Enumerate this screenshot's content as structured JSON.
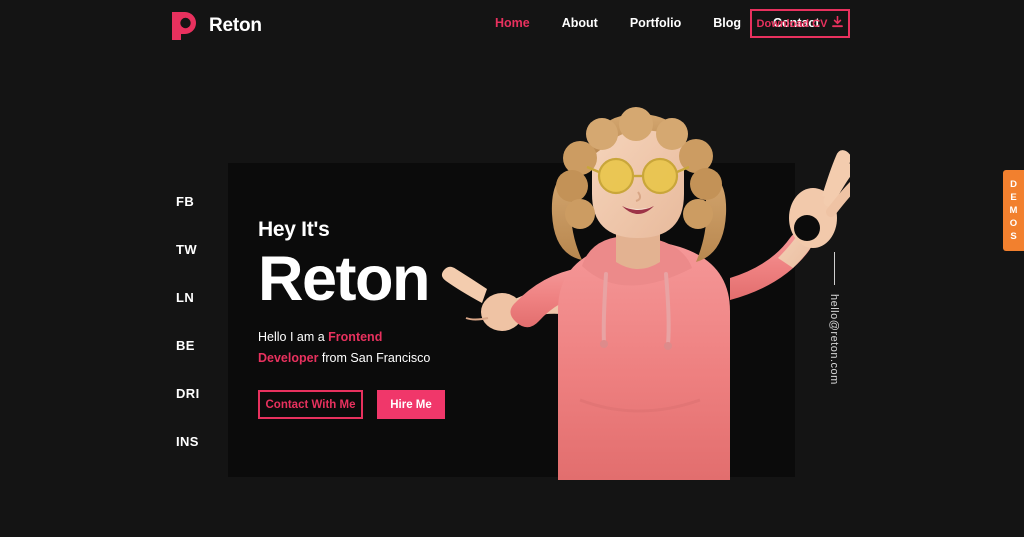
{
  "colors": {
    "background": "#141414",
    "panel": "#0B0B0B",
    "accent_pink": "#E8315E",
    "accent_pink_solid": "#F0376A",
    "demos_orange": "#F2802E",
    "text_white": "#FFFFFF",
    "hoodie_pink": "#F08080",
    "sunglasses_yellow": "#E8C547",
    "hair_blonde": "#C89A67"
  },
  "header": {
    "brand": {
      "name": "Reton",
      "logo_icon": "reton-p-logo-icon"
    },
    "nav": [
      {
        "label": "Home",
        "active": true
      },
      {
        "label": "About",
        "active": false
      },
      {
        "label": "Portfolio",
        "active": false
      },
      {
        "label": "Blog",
        "active": false
      },
      {
        "label": "Contact",
        "active": false
      }
    ],
    "cv_button": {
      "label": "Download CV",
      "icon": "download-icon"
    }
  },
  "social_rail": [
    {
      "label": "FB"
    },
    {
      "label": "TW"
    },
    {
      "label": "LN"
    },
    {
      "label": "BE"
    },
    {
      "label": "DRI"
    },
    {
      "label": "INS"
    }
  ],
  "hero": {
    "greeting": "Hey It's",
    "name": "Reton",
    "tagline_prefix": "Hello I am a ",
    "tagline_role": "Frontend Developer",
    "tagline_suffix": " from San Francisco",
    "buttons": {
      "contact": "Contact With Me",
      "hire": "Hire Me"
    },
    "portrait_alt": "woman-with-yellow-sunglasses-pink-hoodie-ok-gesture"
  },
  "email_rail": {
    "email": "hello@reton.com"
  },
  "demos_tab": {
    "letters": [
      "D",
      "E",
      "M",
      "O",
      "S"
    ],
    "label": "DEMOS"
  }
}
